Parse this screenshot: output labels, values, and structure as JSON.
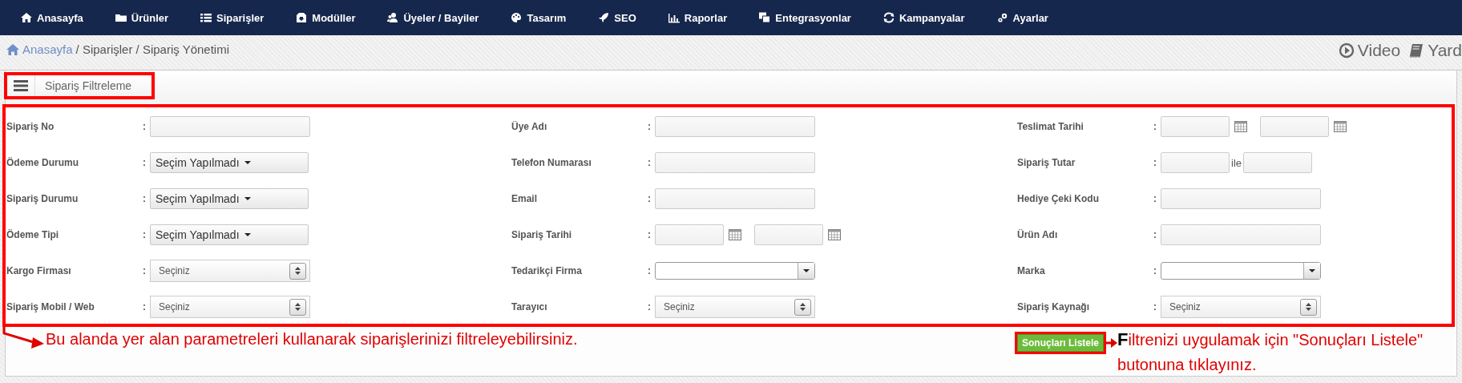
{
  "nav": [
    {
      "label": "Anasayfa"
    },
    {
      "label": "Ürünler"
    },
    {
      "label": "Siparişler"
    },
    {
      "label": "Modüller"
    },
    {
      "label": "Üyeler / Bayiler"
    },
    {
      "label": "Tasarım"
    },
    {
      "label": "SEO"
    },
    {
      "label": "Raporlar"
    },
    {
      "label": "Entegrasyonlar"
    },
    {
      "label": "Kampanyalar"
    },
    {
      "label": "Ayarlar"
    }
  ],
  "breadcrumb": [
    {
      "label": "Anasayfa",
      "link": true
    },
    {
      "label": "/ Siparişler / Sipariş Yönetimi",
      "link": false
    }
  ],
  "help_links": [
    {
      "label": "Video"
    },
    {
      "label": "Yard"
    }
  ],
  "panel": {
    "title": "Sipariş Filtreleme",
    "columns": [
      [
        {
          "label": "Sipariş No",
          "colon": ":",
          "kind": "text"
        },
        {
          "label": "Ödeme Durumu",
          "colon": ":",
          "kind": "dropdown",
          "value": "Seçim Yapılmadı"
        },
        {
          "label": "Sipariş Durumu",
          "colon": ":",
          "kind": "dropdown",
          "value": "Seçim Yapılmadı"
        },
        {
          "label": "Ödeme Tipi",
          "colon": ":",
          "kind": "dropdown",
          "value": "Seçim Yapılmadı"
        },
        {
          "label": "Kargo Firması",
          "colon": ":",
          "kind": "select",
          "value": "Seçiniz"
        },
        {
          "label": "Sipariş Mobil / Web",
          "colon": ":",
          "kind": "select",
          "value": "Seçiniz"
        }
      ],
      [
        {
          "label": "Üye Adı",
          "colon": ":",
          "kind": "text"
        },
        {
          "label": "Telefon Numarası",
          "colon": ":",
          "kind": "text"
        },
        {
          "label": "Email",
          "colon": ":",
          "kind": "text"
        },
        {
          "label": "Sipariş Tarihi",
          "colon": ":",
          "kind": "date_range"
        },
        {
          "label": "Tedarikçi Firma",
          "colon": ":",
          "kind": "combo"
        },
        {
          "label": "Tarayıcı",
          "colon": ":",
          "kind": "select",
          "value": "Seçiniz"
        }
      ],
      [
        {
          "label": "Teslimat Tarihi",
          "colon": ":",
          "kind": "date_range"
        },
        {
          "label": "Sipariş Tutar",
          "colon": ":",
          "kind": "range",
          "separator": "ile"
        },
        {
          "label": "Hediye Çeki Kodu",
          "colon": ":",
          "kind": "text"
        },
        {
          "label": "Ürün Adı",
          "colon": ":",
          "kind": "text"
        },
        {
          "label": "Marka",
          "colon": ":",
          "kind": "combo"
        },
        {
          "label": "Sipariş Kaynağı",
          "colon": ":",
          "kind": "select",
          "value": "Seçiniz"
        }
      ]
    ],
    "submit_button": "Sonuçları Listele",
    "annotations": [
      {
        "text": "Bu alanda yer alan parametreleri kullanarak siparişlerinizi filtreleyebilirsiniz."
      },
      {
        "text": "**F**iltrenizi uygulamak için \"Sonuçları Listele\" butonuna tıklayınız."
      }
    ]
  }
}
